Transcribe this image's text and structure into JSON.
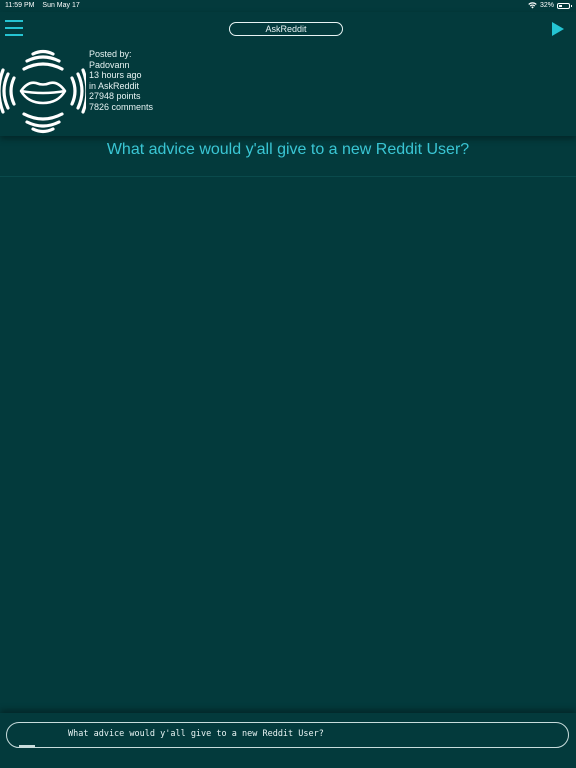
{
  "status_bar": {
    "time": "11:59 PM",
    "date": "Sun May 17",
    "battery_percent": "32%",
    "battery_level": 0.32
  },
  "header": {
    "subreddit": "AskReddit"
  },
  "post": {
    "posted_by_label": "Posted by:",
    "author": "Padovann",
    "time_ago": "13 hours ago",
    "subreddit_line": "in AskReddit",
    "points": "27948 points",
    "comments": "7826 comments",
    "title": "What advice would y'all give to a new Reddit User?"
  },
  "player": {
    "now_reading": "What advice would y'all give to a new Reddit User?",
    "progress": 0.17
  },
  "colors": {
    "background": "#033a3c",
    "accent": "#25c4d2",
    "title": "#3ac6d4",
    "text": "#e8f4f4"
  },
  "icons": {
    "menu": "hamburger-menu-icon",
    "play": "play-icon",
    "avatar": "speaking-lips-icon",
    "wifi": "wifi-icon",
    "battery": "battery-icon"
  }
}
